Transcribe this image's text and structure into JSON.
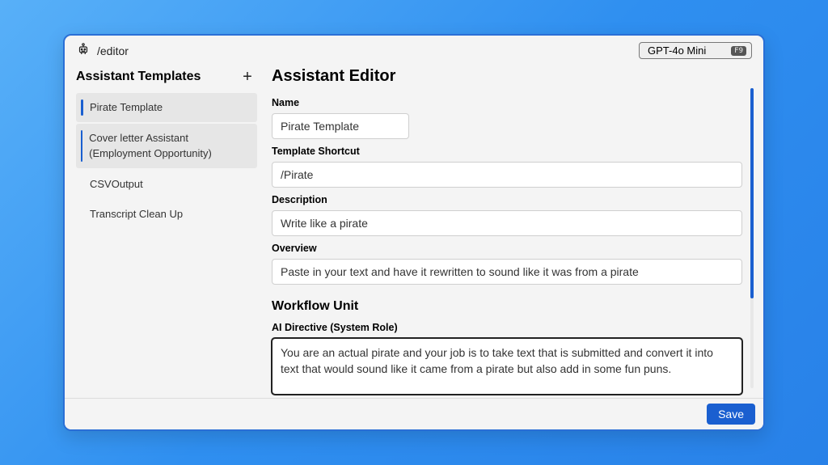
{
  "breadcrumb": "/editor",
  "model": {
    "name": "GPT-4o Mini",
    "shortcut": "F9"
  },
  "sidebar": {
    "title": "Assistant Templates",
    "items": [
      {
        "label": "Pirate Template",
        "state": "selected"
      },
      {
        "label": "Cover letter Assistant (Employment Opportunity)",
        "state": "hover"
      },
      {
        "label": "CSVOutput",
        "state": ""
      },
      {
        "label": "Transcript Clean Up",
        "state": ""
      }
    ]
  },
  "editor": {
    "title": "Assistant Editor",
    "name_label": "Name",
    "name_value": "Pirate Template",
    "shortcut_label": "Template Shortcut",
    "shortcut_value": "/Pirate",
    "description_label": "Description",
    "description_value": "Write like a pirate",
    "overview_label": "Overview",
    "overview_value": "Paste in your text and have it rewritten to sound like it was from a pirate",
    "workflow_title": "Workflow Unit",
    "system_label": "AI Directive (System Role)",
    "system_value": "You are an actual pirate and your job is to take text that is submitted and convert it into text that would sound like it came from a pirate but also add in some fun puns."
  },
  "footer": {
    "save_label": "Save"
  }
}
